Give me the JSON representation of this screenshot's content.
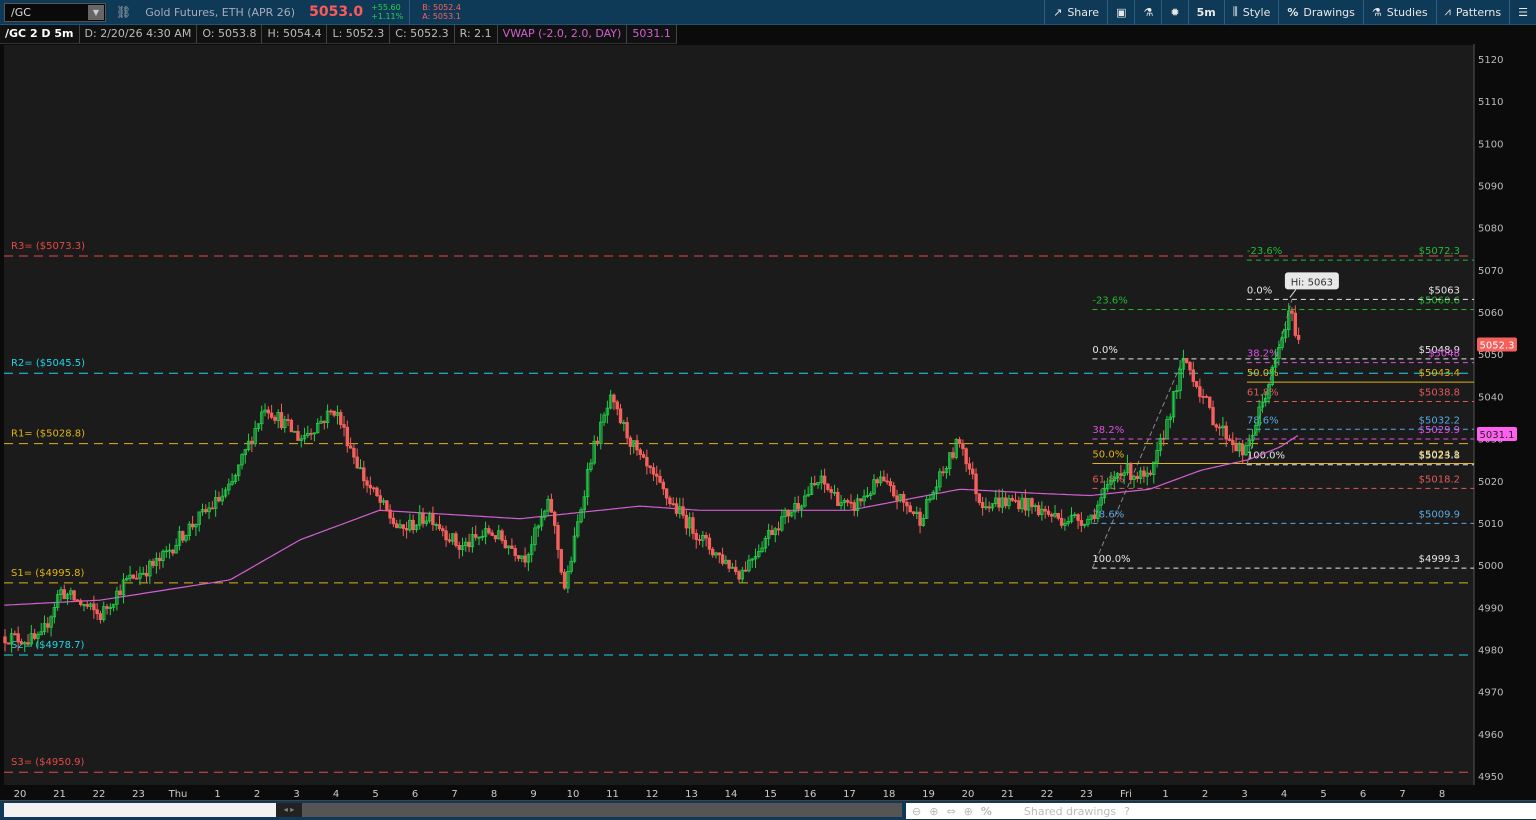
{
  "toolbar": {
    "symbol": "/GC",
    "description": "Gold Futures, ETH (APR 26)",
    "last": "5053.0",
    "change": "+55.60",
    "change_pct": "+1.11%",
    "bid": "B: 5052.4",
    "ask": "A: 5053.1",
    "buttons": {
      "share": "Share",
      "timeframe": "5m",
      "style": "Style",
      "drawings": "Drawings",
      "studies": "Studies",
      "patterns": "Patterns"
    }
  },
  "infobar": {
    "title": "/GC 2 D 5m",
    "date": "D: 2/20/26 4:30 AM",
    "open": "O: 5053.8",
    "high": "H: 5054.4",
    "low": "L: 5052.3",
    "close": "C: 5052.3",
    "range": "R: 2.1",
    "vwap_label": "VWAP (-2.0, 2.0, DAY)",
    "vwap_value": "5031.1"
  },
  "footer": {
    "shared_drawings": "Shared drawings"
  },
  "colors": {
    "up": "#21d04a",
    "down": "#f4605c",
    "vwap": "#d25fd2",
    "red": "#e34a4a",
    "cyan": "#1fd6e6",
    "yellow": "#e0b418",
    "green": "#22b833",
    "white": "#e6e6e6",
    "magenta": "#e050e6",
    "blue": "#5aa8e0",
    "fibred": "#e05a5a"
  },
  "chart_data": {
    "type": "candlestick",
    "ylim": [
      4950,
      5120
    ],
    "yticks": [
      4950,
      4960,
      4970,
      4980,
      4990,
      5000,
      5010,
      5020,
      5030,
      5040,
      5050,
      5060,
      5070,
      5080,
      5090,
      5100,
      5110,
      5120
    ],
    "xticks": [
      "20",
      "21",
      "22",
      "23",
      "Thu",
      "1",
      "2",
      "3",
      "4",
      "5",
      "6",
      "7",
      "8",
      "9",
      "10",
      "11",
      "12",
      "13",
      "14",
      "15",
      "16",
      "17",
      "18",
      "19",
      "20",
      "21",
      "22",
      "23",
      "Fri",
      "1",
      "2",
      "3",
      "4",
      "5",
      "6",
      "7",
      "8"
    ],
    "price_path": [
      [
        -0.38,
        4983
      ],
      [
        0.51,
        4982
      ],
      [
        1.01,
        4994
      ],
      [
        2.03,
        4988
      ],
      [
        2.66,
        4996
      ],
      [
        3.54,
        5001
      ],
      [
        4.18,
        5008
      ],
      [
        5.32,
        5018
      ],
      [
        6.2,
        5038
      ],
      [
        7.09,
        5030
      ],
      [
        7.97,
        5037
      ],
      [
        8.73,
        5020
      ],
      [
        9.62,
        5008
      ],
      [
        10.38,
        5012
      ],
      [
        11.14,
        5004
      ],
      [
        11.9,
        5008
      ],
      [
        12.78,
        5002
      ],
      [
        13.42,
        5015
      ],
      [
        13.8,
        4994
      ],
      [
        14.43,
        5025
      ],
      [
        14.94,
        5039
      ],
      [
        15.7,
        5025
      ],
      [
        16.46,
        5015
      ],
      [
        17.47,
        5004
      ],
      [
        18.23,
        4998
      ],
      [
        18.99,
        5008
      ],
      [
        20.25,
        5020
      ],
      [
        21.01,
        5013
      ],
      [
        21.77,
        5020
      ],
      [
        22.78,
        5011
      ],
      [
        23.8,
        5030
      ],
      [
        24.3,
        5015
      ],
      [
        25.32,
        5015
      ],
      [
        26.33,
        5011
      ],
      [
        27.09,
        5011
      ],
      [
        27.85,
        5023
      ],
      [
        28.61,
        5020
      ],
      [
        29.49,
        5049
      ],
      [
        30.25,
        5034
      ],
      [
        31.01,
        5026
      ],
      [
        31.65,
        5044
      ],
      [
        32.15,
        5060
      ],
      [
        32.41,
        5052.3
      ]
    ],
    "vwap_path": [
      [
        -0.4,
        4990.5
      ],
      [
        2.03,
        4991.7
      ],
      [
        5.32,
        4996.5
      ],
      [
        7.09,
        5006
      ],
      [
        9.1,
        5013
      ],
      [
        12.66,
        5011
      ],
      [
        15.7,
        5014
      ],
      [
        17.2,
        5013
      ],
      [
        21.0,
        5013
      ],
      [
        23.8,
        5018
      ],
      [
        25.8,
        5017
      ],
      [
        27.1,
        5016.5
      ],
      [
        28.6,
        5018
      ],
      [
        29.9,
        5022.5
      ],
      [
        31.1,
        5025
      ],
      [
        31.9,
        5028
      ],
      [
        32.41,
        5031.1
      ]
    ],
    "pivots": [
      {
        "label": "R3= ($5073.3)",
        "value": 5073.3,
        "color": "red"
      },
      {
        "label": "R2= ($5045.5)",
        "value": 5045.5,
        "color": "cyan"
      },
      {
        "label": "R1= ($5028.8)",
        "value": 5028.8,
        "color": "yellow"
      },
      {
        "label": "S1= ($4995.8)",
        "value": 4995.8,
        "color": "yellow"
      },
      {
        "label": "S2= ($4978.7)",
        "value": 4978.7,
        "color": "cyan"
      },
      {
        "label": "S3= ($4950.9)",
        "value": 4950.9,
        "color": "red"
      }
    ],
    "fib_sets": [
      {
        "start_t": 27.15,
        "anchor": [
          [
            27.15,
            4999.3
          ],
          [
            29.45,
            5048.9
          ]
        ],
        "levels": [
          {
            "pct": "-23.6%",
            "price": "$5060.6",
            "value": 5060.6,
            "color": "green"
          },
          {
            "pct": "0.0%",
            "price": "$5048.9",
            "value": 5048.9,
            "color": "white"
          },
          {
            "pct": "38.2%",
            "price": "$5029.9",
            "value": 5029.9,
            "color": "magenta"
          },
          {
            "pct": "50.0%",
            "price": "$5024.1",
            "value": 5024.1,
            "color": "yellow",
            "solid": true
          },
          {
            "pct": "61.8%",
            "price": "$5018.2",
            "value": 5018.2,
            "color": "fibred"
          },
          {
            "pct": "78.6%",
            "price": "$5009.9",
            "value": 5009.9,
            "color": "blue"
          },
          {
            "pct": "100.0%",
            "price": "$4999.3",
            "value": 4999.3,
            "color": "white"
          }
        ]
      },
      {
        "start_t": 31.06,
        "anchor": [
          [
            31.06,
            5023.8
          ],
          [
            32.2,
            5063
          ]
        ],
        "levels": [
          {
            "pct": "-23.6%",
            "price": "$5072.3",
            "value": 5072.3,
            "color": "green"
          },
          {
            "pct": "0.0%",
            "price": "$5063",
            "value": 5063,
            "color": "white"
          },
          {
            "pct": "38.2%",
            "price": "$5048",
            "value": 5048,
            "color": "magenta"
          },
          {
            "pct": "50.0%",
            "price": "$5043.4",
            "value": 5043.4,
            "color": "yellow",
            "solid": true
          },
          {
            "pct": "61.8%",
            "price": "$5038.8",
            "value": 5038.8,
            "color": "fibred"
          },
          {
            "pct": "78.6%",
            "price": "$5032.2",
            "value": 5032.2,
            "color": "blue"
          },
          {
            "pct": "100.0%",
            "price": "$5023.8",
            "value": 5023.8,
            "color": "white"
          }
        ]
      }
    ],
    "high_callout": "Hi: 5063",
    "last_price_label": "5052.3",
    "vwap_price_label": "5031.1"
  }
}
